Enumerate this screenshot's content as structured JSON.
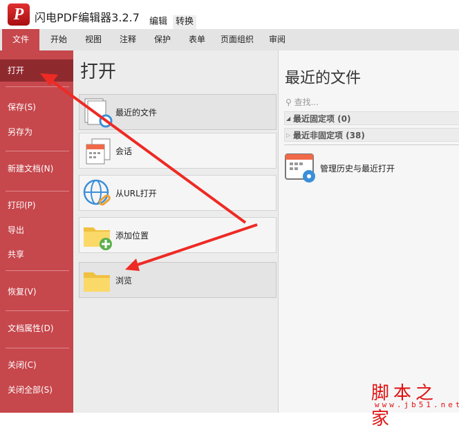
{
  "app": {
    "title": "闪电PDF编辑器3.2.7",
    "context_tabs": [
      "编辑",
      "转换"
    ]
  },
  "menu": {
    "tabs": [
      "文件",
      "开始",
      "视图",
      "注释",
      "保护",
      "表单",
      "页面组织",
      "审阅"
    ]
  },
  "sidebar": {
    "items": [
      "打开",
      "保存(S)",
      "另存为",
      "新建文档(N)",
      "打印(P)",
      "导出",
      "共享",
      "恢复(V)",
      "文档属性(D)",
      "关闭(C)",
      "关闭全部(S)"
    ]
  },
  "open": {
    "title": "打开",
    "options": [
      "最近的文件",
      "会话",
      "从URL打开",
      "添加位置",
      "浏览"
    ]
  },
  "recent": {
    "title": "最近的文件",
    "search_placeholder": "查找...",
    "pinned": "最近固定项 (0)",
    "unpinned": "最近非固定项 (38)",
    "manage": "管理历史与最近打开"
  },
  "watermark": {
    "text": "脚本之家",
    "url": "www.jb51.net"
  },
  "colors": {
    "accent": "#c6474c",
    "selected": "#8e2a2e",
    "arrow": "#ee2a24"
  }
}
